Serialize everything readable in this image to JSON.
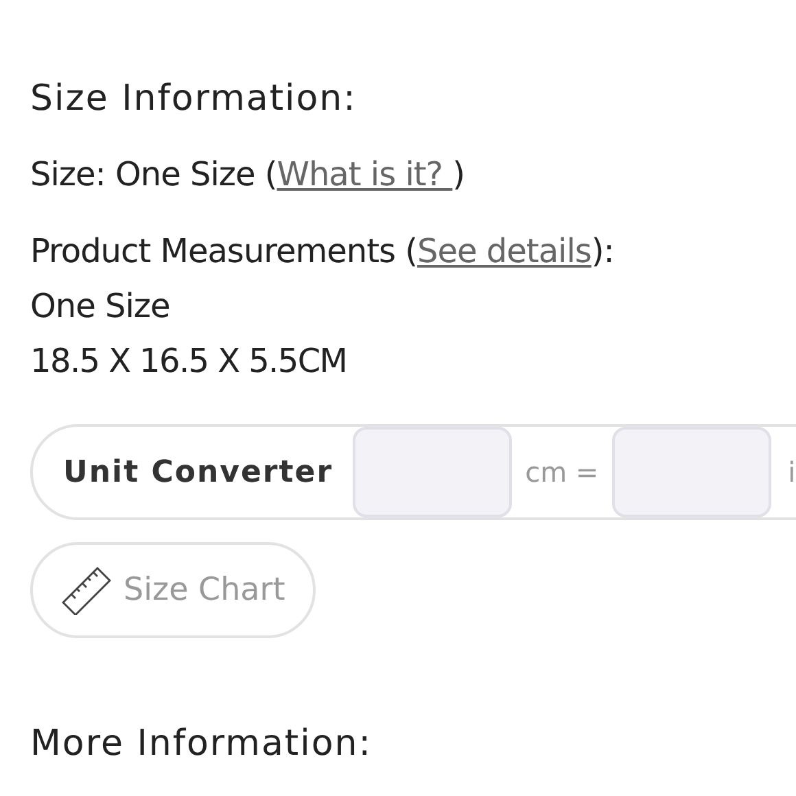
{
  "size_information": {
    "title": "Size Information:",
    "size_label": "Size: One Size (",
    "size_link": "What is it? ",
    "size_close": ")",
    "measurements_label": "Product Measurements (",
    "measurements_link": "See details",
    "measurements_close": "):",
    "measurement_size": "One Size",
    "measurement_value": "18.5 X 16.5 X 5.5CM"
  },
  "unit_converter": {
    "label": "Unit Converter",
    "unit_from": "cm =",
    "unit_to": "i"
  },
  "size_chart_button": "Size Chart",
  "more_information": {
    "title": "More Information:"
  }
}
